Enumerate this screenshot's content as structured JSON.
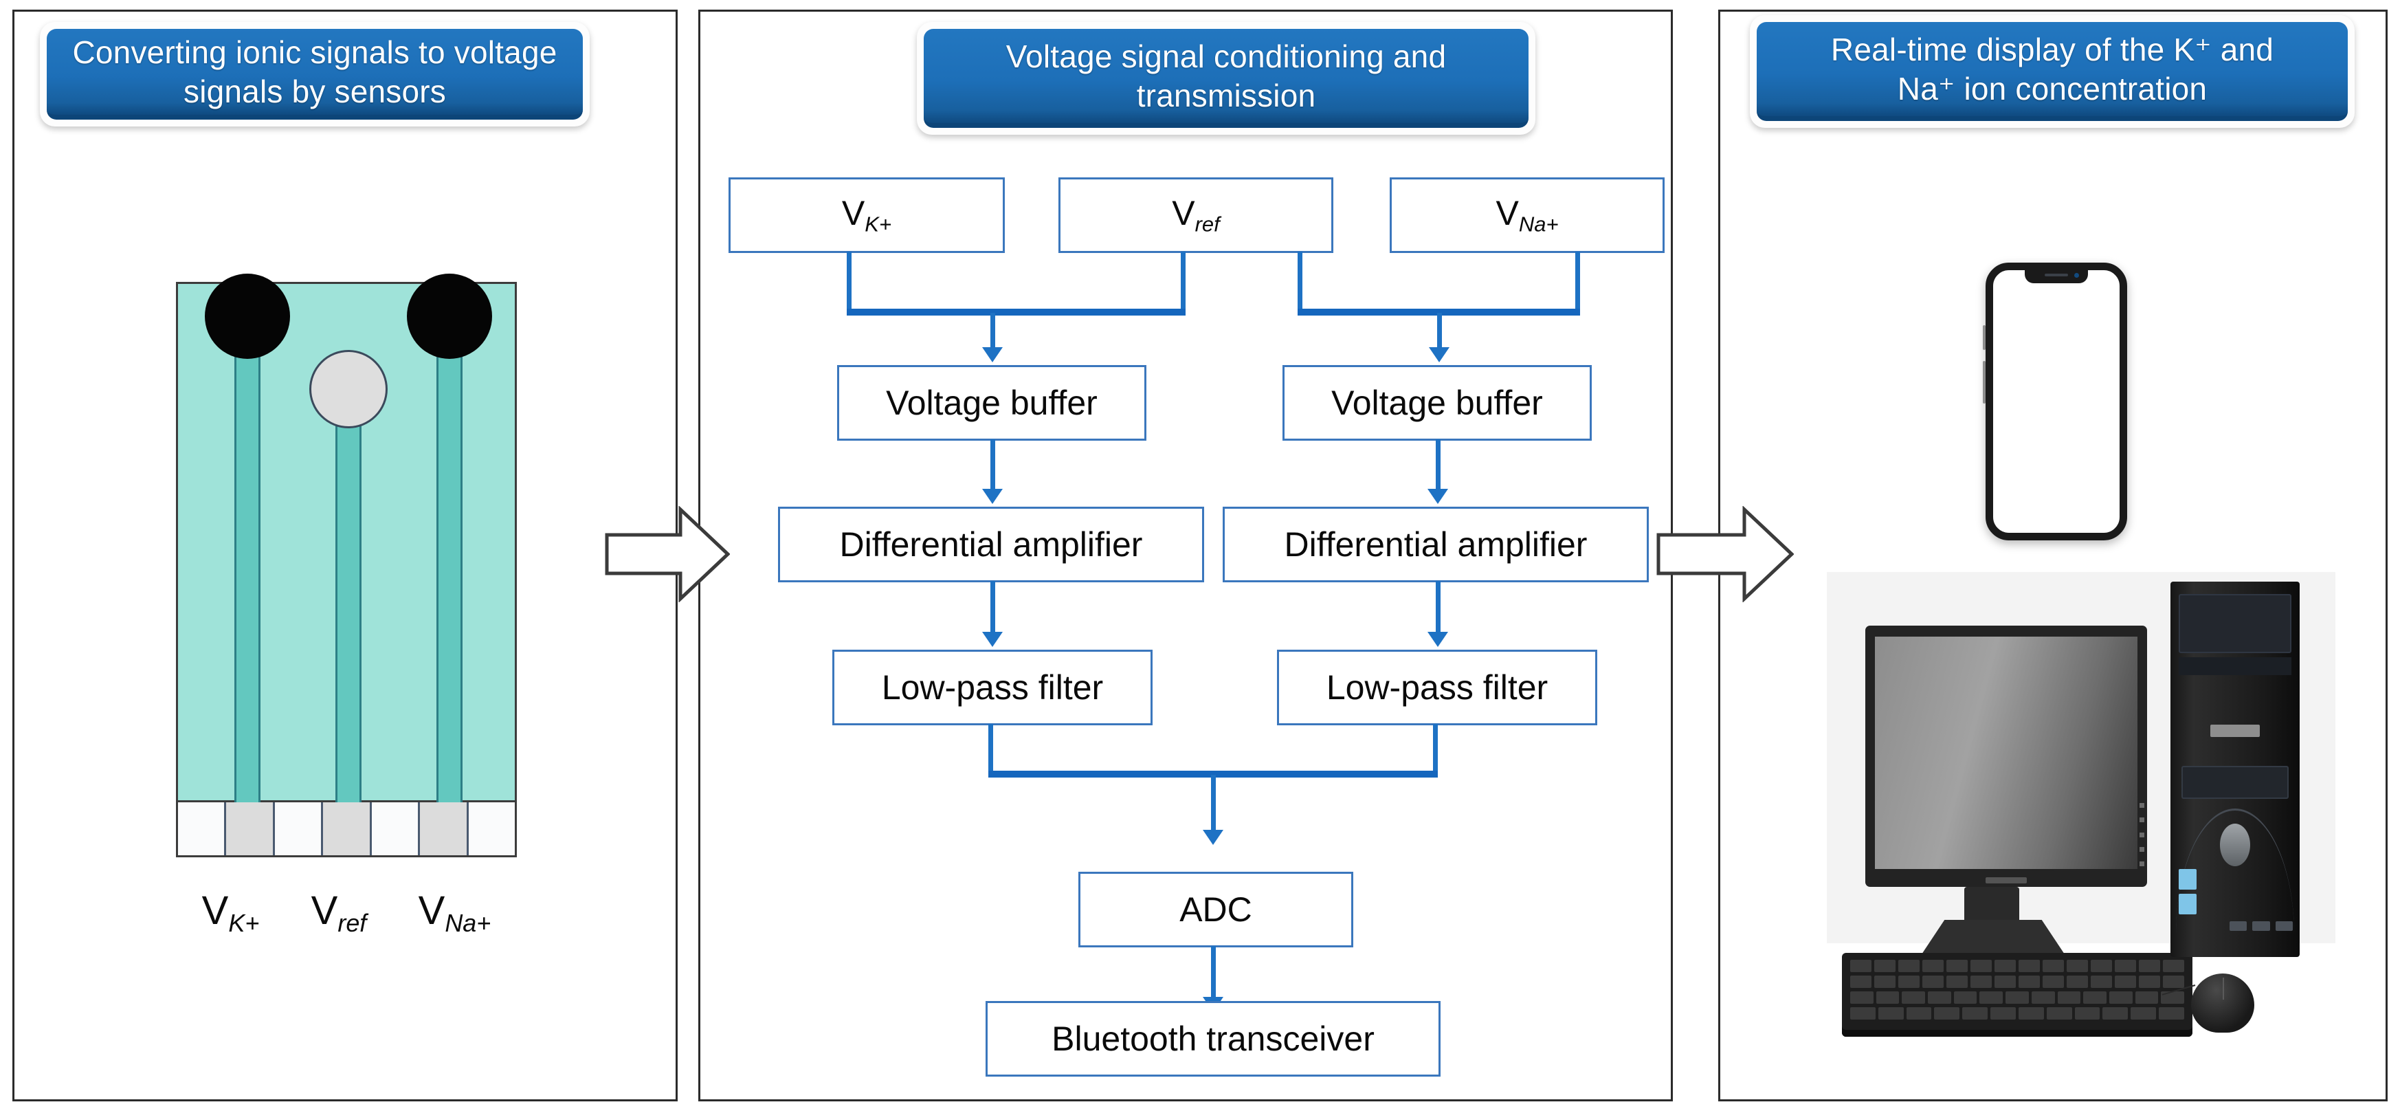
{
  "figure": {
    "title": "Wearable ion sensing system block diagram",
    "accent_blue": "#1d6fb8",
    "flow_line_blue": "#1e72c4",
    "box_border_blue": "#3b77bd",
    "sensor_substrate_color": "#9fe3d9",
    "sensor_trace_color": "#63c8bf"
  },
  "panels": [
    {
      "id": "panel-left",
      "header": "Converting ionic signals to voltage signals by sensors",
      "sensor": {
        "electrodes": [
          {
            "name": "k-electrode",
            "type": "black",
            "label": "V",
            "sub": "K+"
          },
          {
            "name": "ref-electrode",
            "type": "grey",
            "label": "V",
            "sub": "ref"
          },
          {
            "name": "na-electrode",
            "type": "black",
            "label": "V",
            "sub": "Na+"
          }
        ],
        "labels": [
          {
            "main": "V",
            "sub": "K+"
          },
          {
            "main": "V",
            "sub": "ref"
          },
          {
            "main": "V",
            "sub": "Na+"
          }
        ],
        "contact_pads": [
          "white",
          "grey",
          "white",
          "grey",
          "white",
          "grey",
          "white"
        ]
      }
    },
    {
      "id": "panel-mid",
      "header": "Voltage signal conditioning and transmission",
      "inputs": [
        {
          "main": "V",
          "sub": "K+"
        },
        {
          "main": "V",
          "sub": "ref"
        },
        {
          "main": "V",
          "sub": "Na+"
        }
      ],
      "chain_left": [
        "Voltage buffer",
        "Differential amplifier",
        "Low-pass filter"
      ],
      "chain_right": [
        "Voltage buffer",
        "Differential amplifier",
        "Low-pass filter"
      ],
      "tail": [
        "ADC",
        "Bluetooth transceiver"
      ]
    },
    {
      "id": "panel-right",
      "header_line1": "Real-time display of the K⁺ and",
      "header_line2": "Na⁺ ion concentration",
      "devices": [
        "smartphone",
        "desktop-computer"
      ]
    }
  ],
  "stage_arrows": [
    {
      "name": "stage-arrow-1",
      "direction": "right"
    },
    {
      "name": "stage-arrow-2",
      "direction": "right"
    }
  ]
}
